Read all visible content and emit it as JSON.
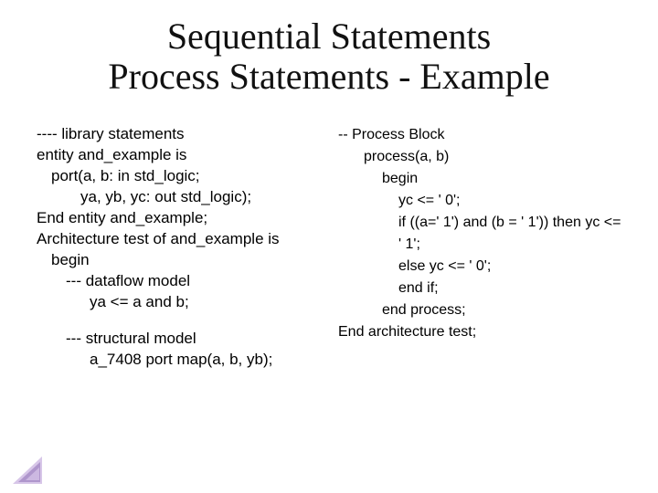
{
  "title_line1": "Sequential Statements",
  "title_line2": "Process Statements - Example",
  "left": {
    "block1": {
      "l0": "---- library statements",
      "l1": "entity and_example is",
      "l2": "port(a, b: in std_logic;",
      "l3": "ya, yb, yc: out std_logic);",
      "l4": "End entity and_example;",
      "l5": "Architecture test of and_example is",
      "l6": "begin",
      "l7": "--- dataflow model",
      "l8": "ya <= a and b;"
    },
    "block2": {
      "l0": "---  structural model",
      "l1": "a_7408 port map(a, b, yb);"
    }
  },
  "right": {
    "l0": "--  Process Block",
    "l1": "process(a, b)",
    "l2": "begin",
    "l3": "yc <= ' 0';",
    "l4": "if ((a=' 1') and (b = ' 1')) then yc <= ' 1';",
    "l5": "else yc <= ' 0';",
    "l6": "end if;",
    "l7": "end process;",
    "l8": "End architecture test;"
  }
}
